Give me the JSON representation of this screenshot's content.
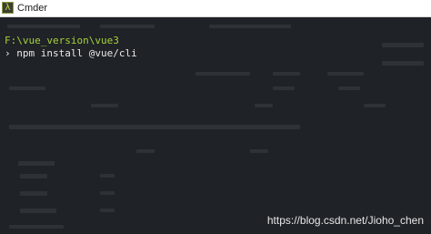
{
  "window": {
    "title": "Cmder",
    "icon": "lambda-icon",
    "icon_glyph": "λ"
  },
  "terminal": {
    "cwd": "F:\\vue_version\\vue3",
    "prompt_symbol": "›",
    "command": " npm install @vue/cli"
  },
  "watermark": "https://blog.csdn.net/Jioho_chen",
  "colors": {
    "terminal_bg": "#1f2226",
    "path_green": "#a6d13c",
    "text": "#e8e8e8"
  }
}
